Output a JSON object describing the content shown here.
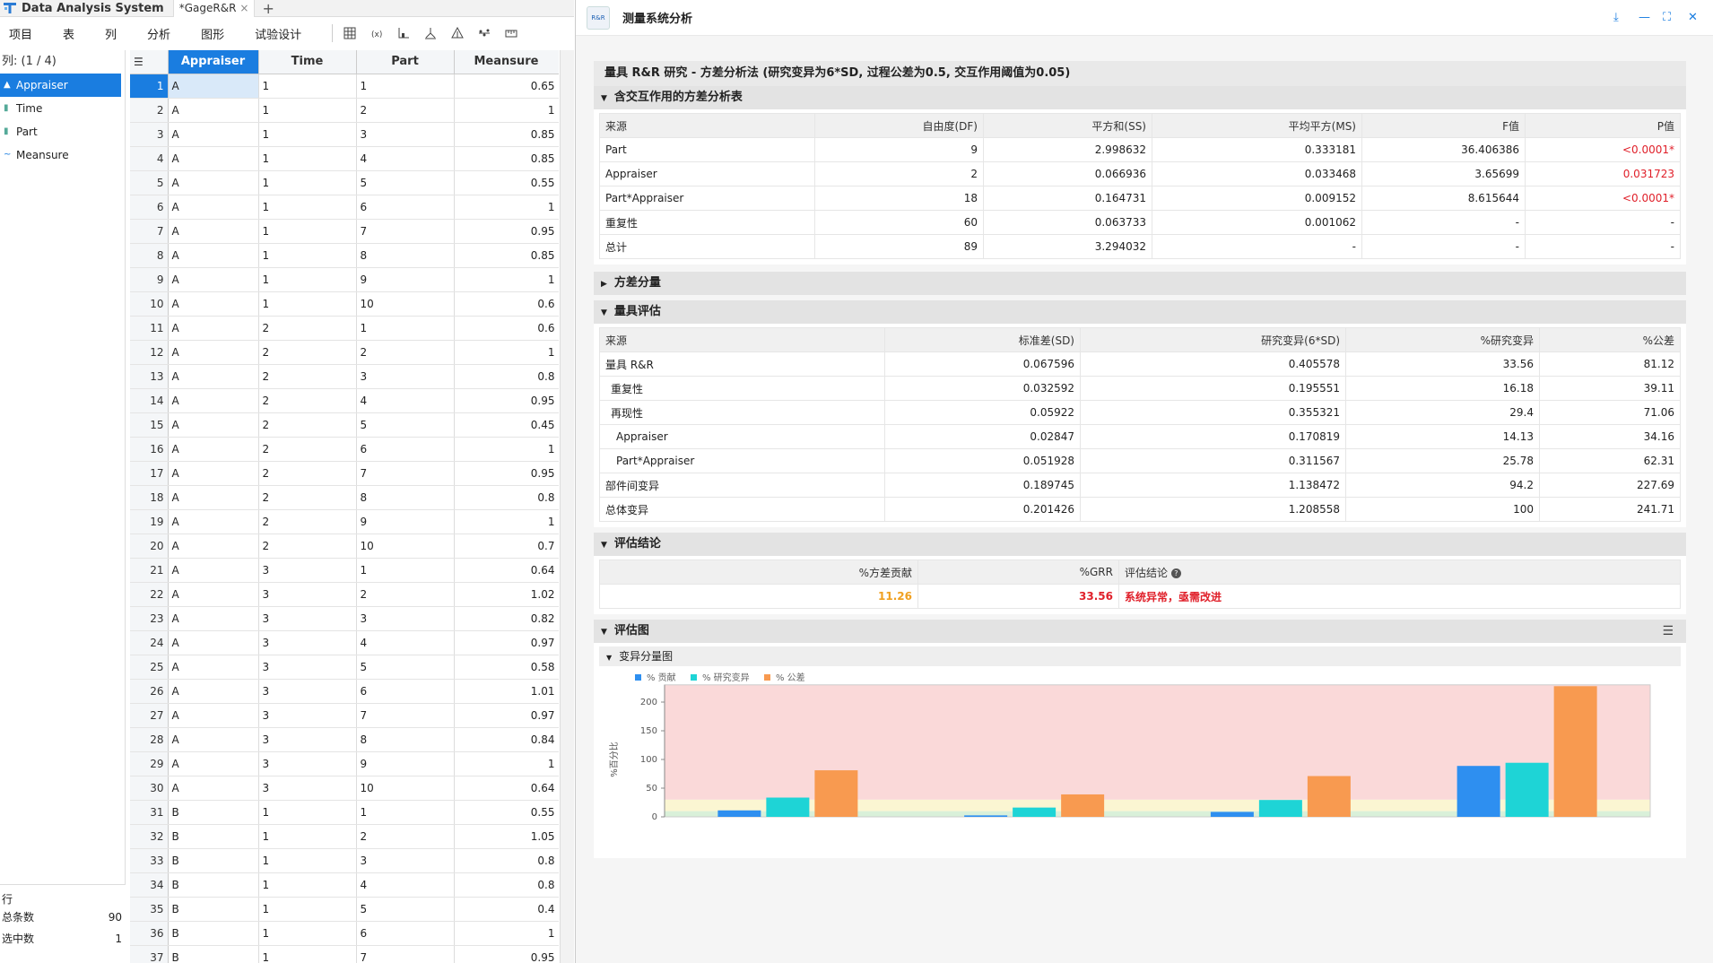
{
  "titlebar": {
    "app_title": "Data Analysis System",
    "doc_tab": "*GageR&R",
    "add": "+",
    "close": "×"
  },
  "menubar": {
    "menus": [
      "项目",
      "表",
      "列",
      "分析",
      "图形",
      "试验设计"
    ]
  },
  "toolbar": {
    "icons": [
      "table-grid-icon",
      "formula-icon",
      "axis-chart-icon",
      "split-icon",
      "tree-icon",
      "scatter-icon",
      "ruler-icon"
    ]
  },
  "columns_panel": {
    "header": "列: (1 / 4)",
    "items": [
      {
        "label": "Appraiser",
        "icon": "nominal-icon",
        "selected": true
      },
      {
        "label": "Time",
        "icon": "ordinal-icon",
        "selected": false
      },
      {
        "label": "Part",
        "icon": "ordinal-icon",
        "selected": false
      },
      {
        "label": "Meansure",
        "icon": "continuous-icon",
        "selected": false
      }
    ]
  },
  "row_stats": {
    "header": "行",
    "total_label": "总条数",
    "total_value": "90",
    "selected_label": "选中数",
    "selected_value": "1"
  },
  "grid": {
    "headers": [
      "Appraiser",
      "Time",
      "Part",
      "Meansure"
    ],
    "rows": [
      [
        "1",
        "A",
        "1",
        "1",
        "0.65"
      ],
      [
        "2",
        "A",
        "1",
        "2",
        "1"
      ],
      [
        "3",
        "A",
        "1",
        "3",
        "0.85"
      ],
      [
        "4",
        "A",
        "1",
        "4",
        "0.85"
      ],
      [
        "5",
        "A",
        "1",
        "5",
        "0.55"
      ],
      [
        "6",
        "A",
        "1",
        "6",
        "1"
      ],
      [
        "7",
        "A",
        "1",
        "7",
        "0.95"
      ],
      [
        "8",
        "A",
        "1",
        "8",
        "0.85"
      ],
      [
        "9",
        "A",
        "1",
        "9",
        "1"
      ],
      [
        "10",
        "A",
        "1",
        "10",
        "0.6"
      ],
      [
        "11",
        "A",
        "2",
        "1",
        "0.6"
      ],
      [
        "12",
        "A",
        "2",
        "2",
        "1"
      ],
      [
        "13",
        "A",
        "2",
        "3",
        "0.8"
      ],
      [
        "14",
        "A",
        "2",
        "4",
        "0.95"
      ],
      [
        "15",
        "A",
        "2",
        "5",
        "0.45"
      ],
      [
        "16",
        "A",
        "2",
        "6",
        "1"
      ],
      [
        "17",
        "A",
        "2",
        "7",
        "0.95"
      ],
      [
        "18",
        "A",
        "2",
        "8",
        "0.8"
      ],
      [
        "19",
        "A",
        "2",
        "9",
        "1"
      ],
      [
        "20",
        "A",
        "2",
        "10",
        "0.7"
      ],
      [
        "21",
        "A",
        "3",
        "1",
        "0.64"
      ],
      [
        "22",
        "A",
        "3",
        "2",
        "1.02"
      ],
      [
        "23",
        "A",
        "3",
        "3",
        "0.82"
      ],
      [
        "24",
        "A",
        "3",
        "4",
        "0.97"
      ],
      [
        "25",
        "A",
        "3",
        "5",
        "0.58"
      ],
      [
        "26",
        "A",
        "3",
        "6",
        "1.01"
      ],
      [
        "27",
        "A",
        "3",
        "7",
        "0.97"
      ],
      [
        "28",
        "A",
        "3",
        "8",
        "0.84"
      ],
      [
        "29",
        "A",
        "3",
        "9",
        "1"
      ],
      [
        "30",
        "A",
        "3",
        "10",
        "0.64"
      ],
      [
        "31",
        "B",
        "1",
        "1",
        "0.55"
      ],
      [
        "32",
        "B",
        "1",
        "2",
        "1.05"
      ],
      [
        "33",
        "B",
        "1",
        "3",
        "0.8"
      ],
      [
        "34",
        "B",
        "1",
        "4",
        "0.8"
      ],
      [
        "35",
        "B",
        "1",
        "5",
        "0.4"
      ],
      [
        "36",
        "B",
        "1",
        "6",
        "1"
      ],
      [
        "37",
        "B",
        "1",
        "7",
        "0.95"
      ]
    ]
  },
  "right_panel": {
    "title": "测量系统分析",
    "logo_text": "R&R",
    "window_controls": [
      "download-icon",
      "minimize-icon",
      "maximize-icon",
      "close-icon"
    ],
    "report_title": "量具 R&R 研究 - 方差分析法 (研究变异为6*SD, 过程公差为0.5, 交互作用阈值为0.05)",
    "anova": {
      "title": "含交互作用的方差分析表",
      "headers": [
        "来源",
        "自由度(DF)",
        "平方和(SS)",
        "平均平方(MS)",
        "F值",
        "P值"
      ],
      "rows": [
        [
          "Part",
          "9",
          "2.998632",
          "0.333181",
          "36.406386",
          "<0.0001*"
        ],
        [
          "Appraiser",
          "2",
          "0.066936",
          "0.033468",
          "3.65699",
          "0.031723"
        ],
        [
          "Part*Appraiser",
          "18",
          "0.164731",
          "0.009152",
          "8.615644",
          "<0.0001*"
        ],
        [
          "重复性",
          "60",
          "0.063733",
          "0.001062",
          "-",
          "-"
        ],
        [
          "总计",
          "89",
          "3.294032",
          "-",
          "-",
          "-"
        ]
      ]
    },
    "variance_components": {
      "title": "方差分量"
    },
    "gage_eval": {
      "title": "量具评估",
      "headers": [
        "来源",
        "标准差(SD)",
        "研究变异(6*SD)",
        "%研究变异",
        "%公差"
      ],
      "rows": [
        [
          "量具 R&R",
          "0.067596",
          "0.405578",
          "33.56",
          "81.12"
        ],
        [
          "重复性",
          "0.032592",
          "0.195551",
          "16.18",
          "39.11"
        ],
        [
          "再现性",
          "0.05922",
          "0.355321",
          "29.4",
          "71.06"
        ],
        [
          "Appraiser",
          "0.02847",
          "0.170819",
          "14.13",
          "34.16"
        ],
        [
          "Part*Appraiser",
          "0.051928",
          "0.311567",
          "25.78",
          "62.31"
        ],
        [
          "部件间变异",
          "0.189745",
          "1.138472",
          "94.2",
          "227.69"
        ],
        [
          "总体变异",
          "0.201426",
          "1.208558",
          "100",
          "241.71"
        ]
      ]
    },
    "conclusion": {
      "title": "评估结论",
      "headers": [
        "%方差贡献",
        "%GRR",
        "评估结论"
      ],
      "contribution": "11.26",
      "grr": "33.56",
      "verdict": "系统异常，亟需改进",
      "colors": {
        "contribution": "#f0a020",
        "grr": "#e0202a",
        "verdict": "#e0202a"
      }
    },
    "eval_chart": {
      "title": "评估图",
      "menu_icon": "hamburger-icon",
      "sub_title": "变异分量图"
    }
  },
  "chart_data": {
    "type": "bar",
    "ylabel": "%百分比",
    "ylim": [
      0,
      230
    ],
    "yticks": [
      "0",
      "50",
      "100",
      "150",
      "200"
    ],
    "legend": [
      "% 贡献",
      "% 研究变异",
      "% 公差"
    ],
    "colors": [
      "#2e8ff0",
      "#1ed4d6",
      "#f89a50"
    ],
    "band_colors": [
      "#d9f0d9",
      "#fbf6d2",
      "#fad9d9"
    ],
    "bands": [
      [
        0,
        10
      ],
      [
        10,
        30
      ],
      [
        30,
        230
      ]
    ],
    "series": [
      {
        "name": "% 贡献",
        "values": [
          11.26,
          2.56,
          8.64,
          88.74
        ]
      },
      {
        "name": "% 研究变异",
        "values": [
          33.56,
          16.18,
          29.4,
          94.2
        ]
      },
      {
        "name": "% 公差",
        "values": [
          81.12,
          39.11,
          71.06,
          227.69
        ]
      }
    ]
  }
}
